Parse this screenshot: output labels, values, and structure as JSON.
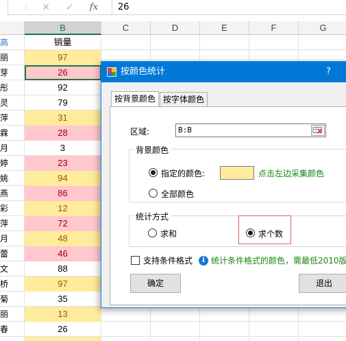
{
  "formula_bar": {
    "more_glyph": "⋮",
    "cancel_glyph": "✕",
    "enter_glyph": "✓",
    "fx_label": "fx",
    "value": "26"
  },
  "columns": {
    "b": "B",
    "c": "C",
    "d": "D",
    "e": "E",
    "f": "F",
    "g": "G"
  },
  "colors": {
    "yellow_fill": "#ffeb9c",
    "yellow_text": "#9c5700",
    "pink_fill": "#ffc7ce",
    "pink_text": "#9c0006",
    "selected_header": "#217346",
    "dialog_title": "#0078d7"
  },
  "rows": [
    {
      "a": "高",
      "b": "销量",
      "style": "header"
    },
    {
      "a": "丽",
      "b": "97",
      "style": "yellow"
    },
    {
      "a": "芽",
      "b": "26",
      "style": "pink"
    },
    {
      "a": "彤",
      "b": "92",
      "style": "plain"
    },
    {
      "a": "灵",
      "b": "79",
      "style": "plain"
    },
    {
      "a": "萍",
      "b": "31",
      "style": "yellow"
    },
    {
      "a": "霖",
      "b": "28",
      "style": "pink"
    },
    {
      "a": "月",
      "b": "3",
      "style": "plain"
    },
    {
      "a": "婷",
      "b": "23",
      "style": "pink"
    },
    {
      "a": "姚",
      "b": "94",
      "style": "yellow"
    },
    {
      "a": "燕",
      "b": "86",
      "style": "pink"
    },
    {
      "a": "彩",
      "b": "12",
      "style": "yellow"
    },
    {
      "a": "萍",
      "b": "72",
      "style": "pink"
    },
    {
      "a": "月",
      "b": "48",
      "style": "yellow"
    },
    {
      "a": "蕾",
      "b": "46",
      "style": "pink"
    },
    {
      "a": "文",
      "b": "88",
      "style": "plain"
    },
    {
      "a": "桥",
      "b": "97",
      "style": "yellow"
    },
    {
      "a": "菊",
      "b": "35",
      "style": "plain"
    },
    {
      "a": "丽",
      "b": "13",
      "style": "yellow"
    },
    {
      "a": "春",
      "b": "26",
      "style": "plain"
    },
    {
      "a": "",
      "b": "",
      "style": "yellow"
    }
  ],
  "dialog": {
    "title": "按颜色统计",
    "help": "?",
    "tabs": [
      "按背景颜色",
      "按字体颜色"
    ],
    "region_label": "区域:",
    "region_value": "B:B",
    "bg_group_title": "背景颜色",
    "specified_color_label": "指定的颜色:",
    "pick_hint": "点击左边采集颜色",
    "all_colors_label": "全部颜色",
    "stat_group_title": "统计方式",
    "sum_label": "求和",
    "count_label": "求个数",
    "conditional_label": "支持条件格式",
    "info_glyph": "i",
    "info_text": "统计条件格式的颜色，需最低2010版",
    "ok_label": "确定",
    "exit_label": "退出"
  }
}
